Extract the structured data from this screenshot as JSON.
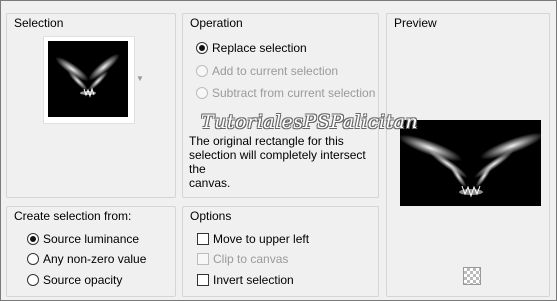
{
  "selection_group": {
    "title": "Selection",
    "dropdown_icon": "chevron-down-icon"
  },
  "operation_group": {
    "title": "Operation",
    "options": [
      {
        "label": "Replace selection",
        "checked": true,
        "enabled": true
      },
      {
        "label": "Add to current selection",
        "checked": false,
        "enabled": false
      },
      {
        "label": "Subtract from current selection",
        "checked": false,
        "enabled": false
      }
    ],
    "info_line1": "The original rectangle for this",
    "info_line2": "selection will completely intersect the",
    "info_line3": "canvas."
  },
  "watermark": "TutorialesPSPalicitan",
  "preview_group": {
    "title": "Preview",
    "transparency_icon": "checkerboard-icon"
  },
  "create_group": {
    "title": "Create selection from:",
    "options": [
      {
        "label": "Source luminance",
        "checked": true
      },
      {
        "label": "Any non-zero value",
        "checked": false
      },
      {
        "label": "Source opacity",
        "checked": false
      }
    ]
  },
  "options_group": {
    "title": "Options",
    "items": [
      {
        "label": "Move to upper left",
        "checked": false,
        "enabled": true
      },
      {
        "label": "Clip to canvas",
        "checked": false,
        "enabled": false
      },
      {
        "label": "Invert selection",
        "checked": false,
        "enabled": true
      }
    ]
  }
}
